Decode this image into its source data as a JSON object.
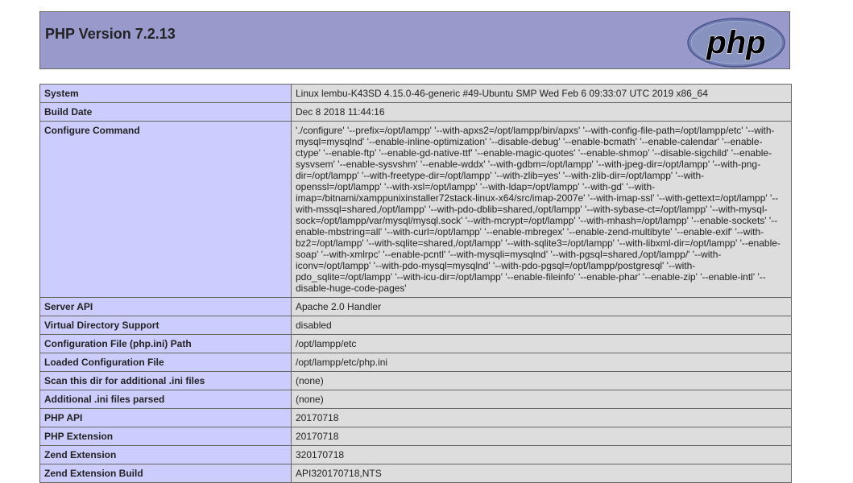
{
  "header": {
    "title": "PHP Version 7.2.13",
    "logo_text": "php",
    "logo_icon": "php-logo-icon"
  },
  "colors": {
    "header_bg": "#9999cc",
    "key_cell_bg": "#ccccff",
    "value_cell_bg": "#dddddd",
    "border": "#666666"
  },
  "rows": [
    {
      "key": "System",
      "value": "Linux lembu-K43SD 4.15.0-46-generic #49-Ubuntu SMP Wed Feb 6 09:33:07 UTC 2019 x86_64"
    },
    {
      "key": "Build Date",
      "value": "Dec 8 2018 11:44:16"
    },
    {
      "key": "Configure Command",
      "value": "'./configure' '--prefix=/opt/lampp' '--with-apxs2=/opt/lampp/bin/apxs' '--with-config-file-path=/opt/lampp/etc' '--with-mysql=mysqlnd' '--enable-inline-optimization' '--disable-debug' '--enable-bcmath' '--enable-calendar' '--enable-ctype' '--enable-ftp' '--enable-gd-native-ttf' '--enable-magic-quotes' '--enable-shmop' '--disable-sigchild' '--enable-sysvsem' '--enable-sysvshm' '--enable-wddx' '--with-gdbm=/opt/lampp' '--with-jpeg-dir=/opt/lampp' '--with-png-dir=/opt/lampp' '--with-freetype-dir=/opt/lampp' '--with-zlib=yes' '--with-zlib-dir=/opt/lampp' '--with-openssl=/opt/lampp' '--with-xsl=/opt/lampp' '--with-ldap=/opt/lampp' '--with-gd' '--with-imap=/bitnami/xamppunixinstaller72stack-linux-x64/src/imap-2007e' '--with-imap-ssl' '--with-gettext=/opt/lampp' '--with-mssql=shared,/opt/lampp' '--with-pdo-dblib=shared,/opt/lampp' '--with-sybase-ct=/opt/lampp' '--with-mysql-sock=/opt/lampp/var/mysql/mysql.sock' '--with-mcrypt=/opt/lampp' '--with-mhash=/opt/lampp' '--enable-sockets' '--enable-mbstring=all' '--with-curl=/opt/lampp' '--enable-mbregex' '--enable-zend-multibyte' '--enable-exif' '--with-bz2=/opt/lampp' '--with-sqlite=shared,/opt/lampp' '--with-sqlite3=/opt/lampp' '--with-libxml-dir=/opt/lampp' '--enable-soap' '--with-xmlrpc' '--enable-pcntl' '--with-mysqli=mysqlnd' '--with-pgsql=shared,/opt/lampp/' '--with-iconv=/opt/lampp' '--with-pdo-mysql=mysqlnd' '--with-pdo-pgsql=/opt/lampp/postgresql' '--with-pdo_sqlite=/opt/lampp' '--with-icu-dir=/opt/lampp' '--enable-fileinfo' '--enable-phar' '--enable-zip' '--enable-intl' '--disable-huge-code-pages'"
    },
    {
      "key": "Server API",
      "value": "Apache 2.0 Handler"
    },
    {
      "key": "Virtual Directory Support",
      "value": "disabled"
    },
    {
      "key": "Configuration File (php.ini) Path",
      "value": "/opt/lampp/etc"
    },
    {
      "key": "Loaded Configuration File",
      "value": "/opt/lampp/etc/php.ini"
    },
    {
      "key": "Scan this dir for additional .ini files",
      "value": "(none)"
    },
    {
      "key": "Additional .ini files parsed",
      "value": "(none)"
    },
    {
      "key": "PHP API",
      "value": "20170718"
    },
    {
      "key": "PHP Extension",
      "value": "20170718"
    },
    {
      "key": "Zend Extension",
      "value": "320170718"
    },
    {
      "key": "Zend Extension Build",
      "value": "API320170718,NTS"
    }
  ]
}
